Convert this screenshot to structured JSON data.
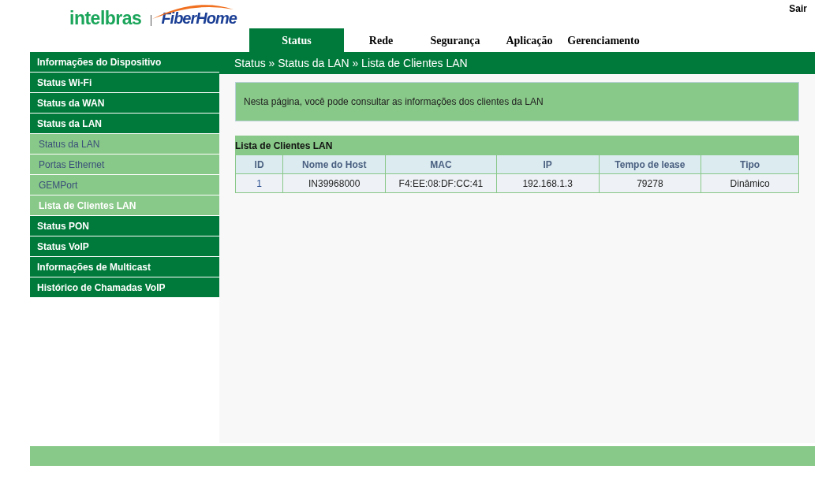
{
  "header": {
    "logo_left": "intelbras",
    "logo_right": "FiberHome",
    "logout": "Sair"
  },
  "tabs": [
    {
      "label": "Status",
      "selected": true
    },
    {
      "label": "Rede",
      "selected": false
    },
    {
      "label": "Segurança",
      "selected": false
    },
    {
      "label": "Aplicação",
      "selected": false
    },
    {
      "label": "Gerenciamento",
      "selected": false
    }
  ],
  "sidebar": {
    "items": [
      {
        "label": "Informações do Dispositivo",
        "kind": "group",
        "selected": false
      },
      {
        "label": "Status Wi-Fi",
        "kind": "group",
        "selected": false
      },
      {
        "label": "Status da WAN",
        "kind": "group",
        "selected": false
      },
      {
        "label": "Status da LAN",
        "kind": "group",
        "selected": false
      },
      {
        "label": "Status da LAN",
        "kind": "sub",
        "selected": false
      },
      {
        "label": "Portas Ethernet",
        "kind": "sub",
        "selected": false
      },
      {
        "label": "GEMPort",
        "kind": "sub",
        "selected": false
      },
      {
        "label": "Lista de Clientes LAN",
        "kind": "sub",
        "selected": true
      },
      {
        "label": "Status PON",
        "kind": "group",
        "selected": false
      },
      {
        "label": "Status VoIP",
        "kind": "group",
        "selected": false
      },
      {
        "label": "Informações de Multicast",
        "kind": "group",
        "selected": false
      },
      {
        "label": "Histórico de Chamadas VoIP",
        "kind": "group",
        "selected": false
      }
    ]
  },
  "breadcrumb": "Status » Status da LAN » Lista de Clientes LAN",
  "info": "Nesta página, você pode consultar as informações dos clientes da LAN",
  "table": {
    "title": "Lista de Clientes LAN",
    "columns": [
      "ID",
      "Nome do Host",
      "MAC",
      "IP",
      "Tempo de lease",
      "Tipo"
    ],
    "rows": [
      [
        "1",
        "IN39968000",
        "F4:EE:08:DF:CC:41",
        "192.168.1.3",
        "79278",
        "Dinâmico"
      ]
    ]
  }
}
